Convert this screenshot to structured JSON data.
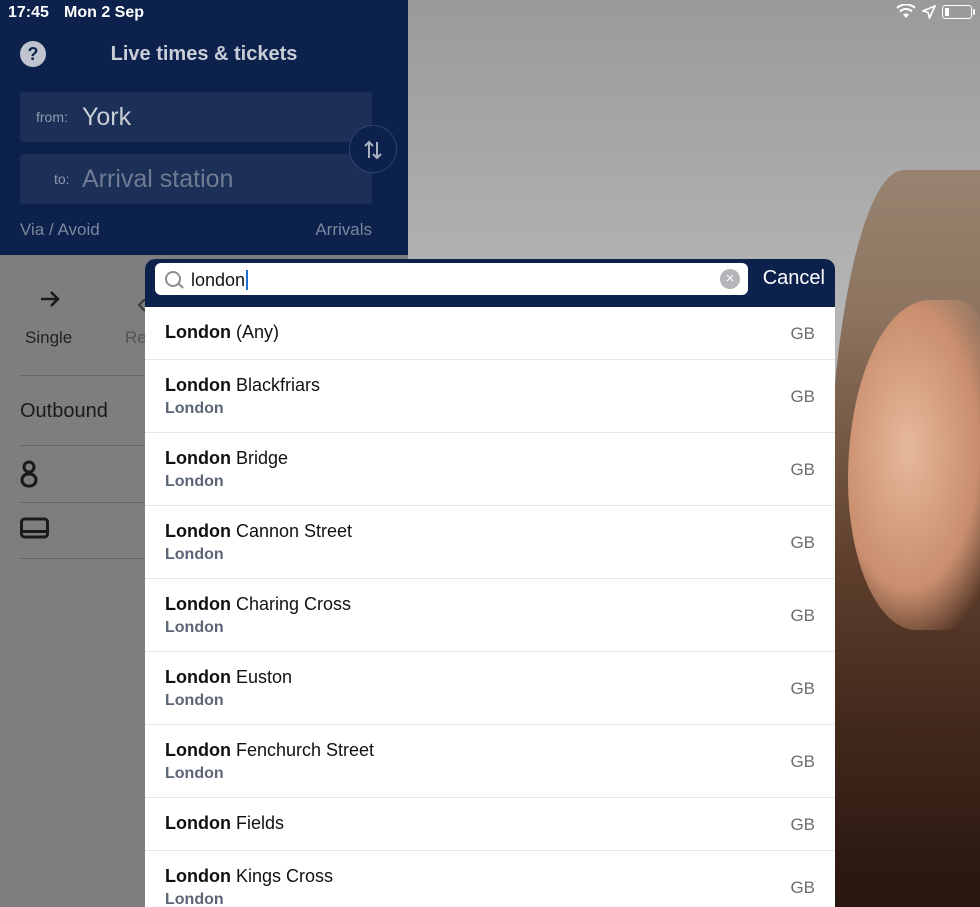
{
  "status_bar": {
    "time": "17:45",
    "date": "Mon 2 Sep"
  },
  "header": {
    "title": "Live times & tickets",
    "help_icon": "?"
  },
  "journey": {
    "from_label": "from:",
    "from_value": "York",
    "to_label": "to:",
    "to_placeholder": "Arrival station",
    "via_label": "Via / Avoid",
    "arrivals_label": "Arrivals"
  },
  "ticket_type": {
    "single_label": "Single",
    "return_partial": "Re"
  },
  "outbound_label": "Outbound",
  "search": {
    "query": "london",
    "cancel_label": "Cancel"
  },
  "results": [
    {
      "bold": "London",
      "rest": " (Any)",
      "sub": "",
      "country": "GB"
    },
    {
      "bold": "London",
      "rest": " Blackfriars",
      "sub": "London",
      "country": "GB"
    },
    {
      "bold": "London",
      "rest": " Bridge",
      "sub": "London",
      "country": "GB"
    },
    {
      "bold": "London",
      "rest": " Cannon Street",
      "sub": "London",
      "country": "GB"
    },
    {
      "bold": "London",
      "rest": " Charing Cross",
      "sub": "London",
      "country": "GB"
    },
    {
      "bold": "London",
      "rest": " Euston",
      "sub": "London",
      "country": "GB"
    },
    {
      "bold": "London",
      "rest": " Fenchurch Street",
      "sub": "London",
      "country": "GB"
    },
    {
      "bold": "London",
      "rest": " Fields",
      "sub": "",
      "country": "GB"
    },
    {
      "bold": "London",
      "rest": " Kings Cross",
      "sub": "London",
      "country": "GB"
    }
  ],
  "colors": {
    "navy": "#0c214c",
    "field": "#1c2f57",
    "caret": "#1d6cd8"
  }
}
